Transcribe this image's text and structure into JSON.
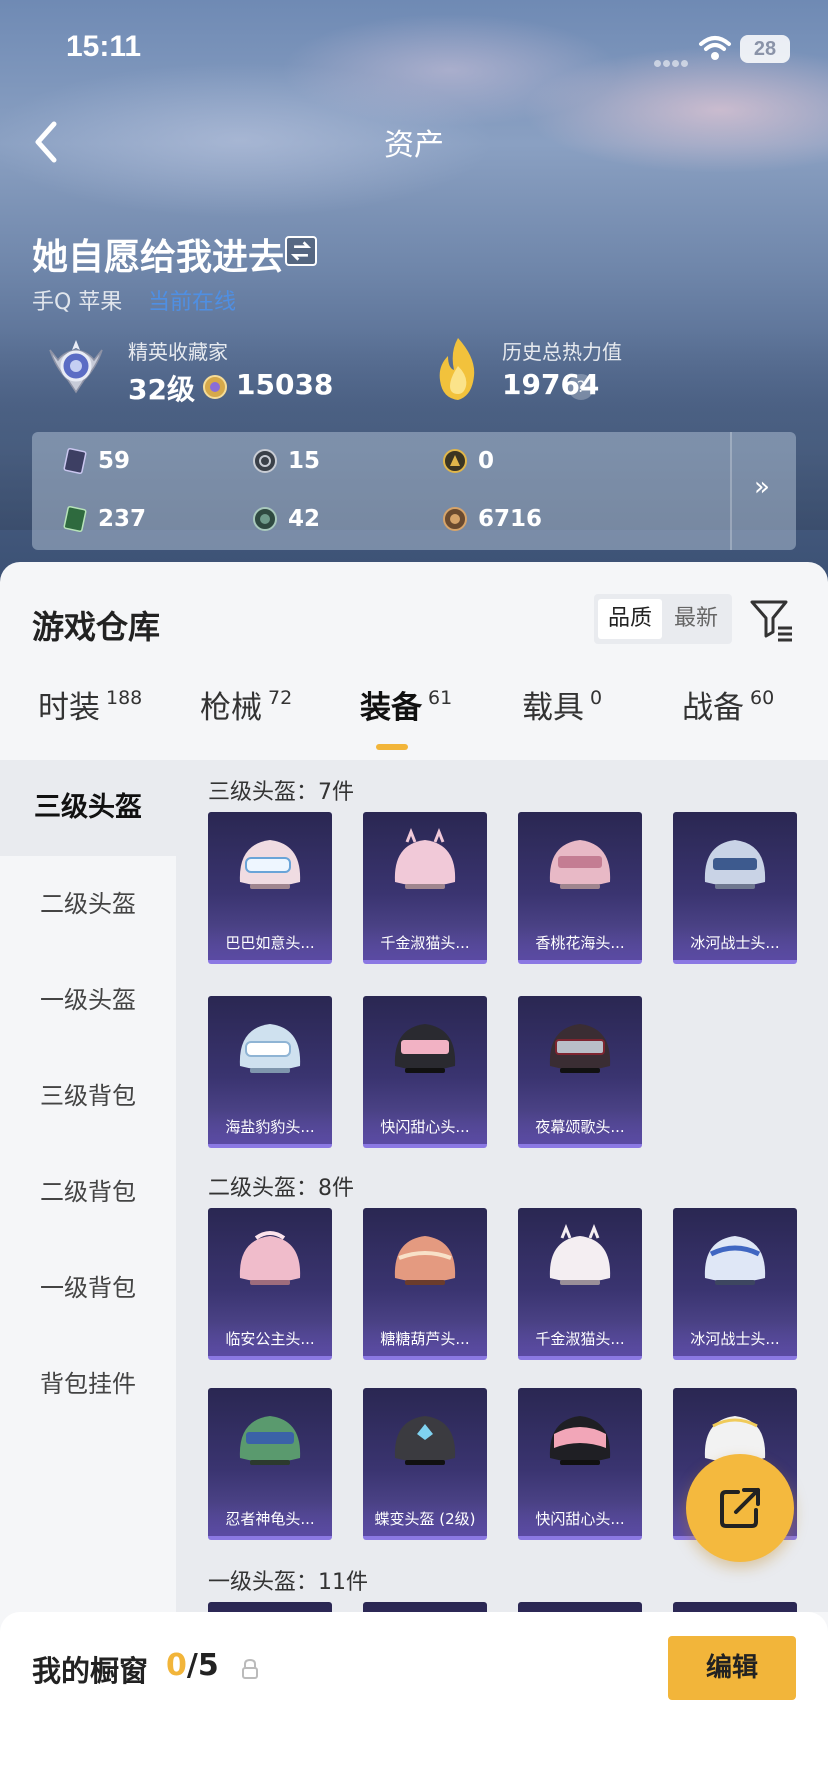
{
  "status_bar": {
    "time": "15:11",
    "battery": "28"
  },
  "nav": {
    "title": "资产"
  },
  "profile": {
    "name": "她自愿给我进去",
    "platform": "手Q 苹果",
    "online_status": "当前在线",
    "rank_title": "精英收藏家",
    "level": "32级",
    "coins": "15038",
    "heat_title": "历史总热力值",
    "heat_value": "19764",
    "help": "?"
  },
  "resources": {
    "items": [
      {
        "icon": "dark-card-icon",
        "value": "59"
      },
      {
        "icon": "gray-ring-coin-icon",
        "value": "15"
      },
      {
        "icon": "gold-ring-coin-icon",
        "value": "0"
      },
      {
        "icon": "green-card-icon",
        "value": "237"
      },
      {
        "icon": "green-orb-icon",
        "value": "42"
      },
      {
        "icon": "bronze-coin-icon",
        "value": "6716"
      }
    ],
    "more": "»"
  },
  "warehouse": {
    "title": "游戏仓库",
    "sort_active": "品质",
    "sort_other": "最新"
  },
  "tabs": [
    {
      "label": "时装",
      "count": "188"
    },
    {
      "label": "枪械",
      "count": "72"
    },
    {
      "label": "装备",
      "count": "61"
    },
    {
      "label": "载具",
      "count": "0"
    },
    {
      "label": "战备",
      "count": "60"
    }
  ],
  "sidebar": [
    "三级头盔",
    "二级头盔",
    "一级头盔",
    "三级背包",
    "二级背包",
    "一级背包",
    "背包挂件"
  ],
  "sections": {
    "lvl3": {
      "title": "三级头盔：7件",
      "items": [
        "巴巴如意头...",
        "千金淑猫头...",
        "香桃花海头...",
        "冰河战士头...",
        "海盐豹豹头...",
        "快闪甜心头...",
        "夜幕颂歌头..."
      ]
    },
    "lvl2": {
      "title": "二级头盔：8件",
      "items": [
        "临安公主头...",
        "糖糖葫芦头...",
        "千金淑猫头...",
        "冰河战士头...",
        "忍者神龟头...",
        "蝶变头盔 (2级)",
        "快闪甜心头...",
        ""
      ]
    },
    "lvl1": {
      "title": "一级头盔：11件"
    }
  },
  "helmet_colors": {
    "lvl3": [
      "#f0dce2",
      "#f1c9d8",
      "#e8b9c6",
      "#c9d3e6",
      "#cfe1ef",
      "#2a2a30",
      "#3a2d33"
    ],
    "lvl2": [
      "#f0bccb",
      "#e49a80",
      "#f4eef2",
      "#dfe7f6",
      "#5a9a6e",
      "#3b3b40",
      "#1f1f24",
      "#f2f2f2"
    ]
  },
  "showcase": {
    "title": "我的橱窗",
    "current": "0",
    "total": "/5"
  },
  "edit_label": "编辑"
}
